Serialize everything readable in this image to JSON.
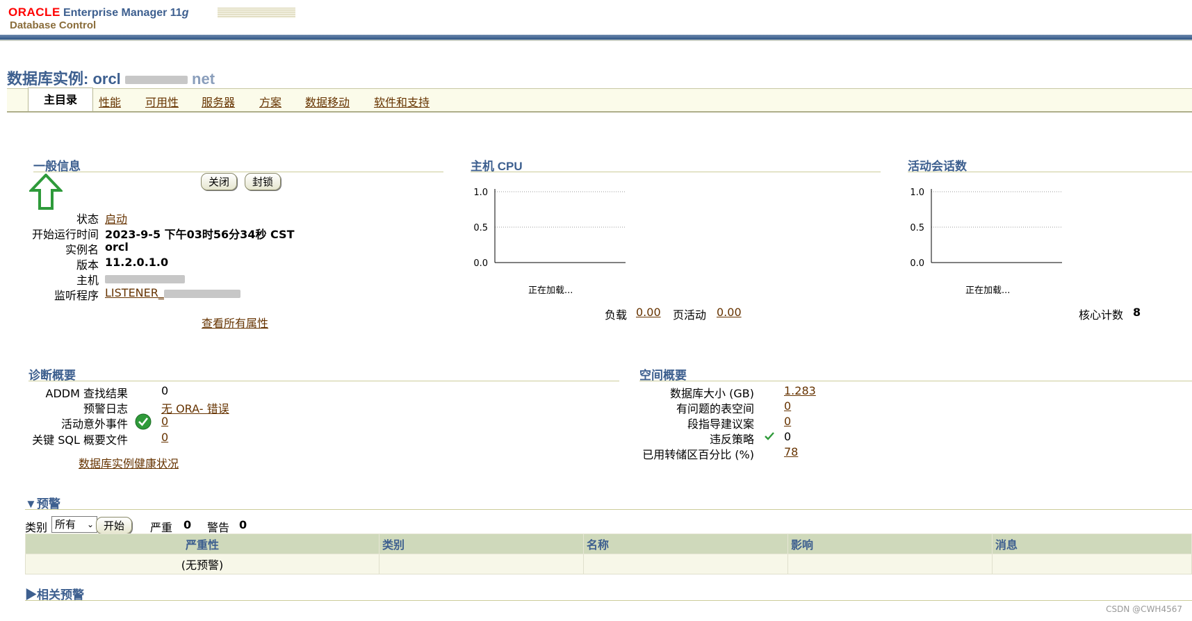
{
  "header": {
    "oracle": "ORACLE",
    "product": "Enterprise Manager 11",
    "product_version": "g",
    "subtitle": "Database Control"
  },
  "page": {
    "title_prefix": "数据库实例: orcl",
    "title_suffix": "net"
  },
  "tabs": [
    {
      "label": "主目录",
      "active": true
    },
    {
      "label": "性能"
    },
    {
      "label": "可用性"
    },
    {
      "label": "服务器"
    },
    {
      "label": "方案"
    },
    {
      "label": "数据移动"
    },
    {
      "label": "软件和支持"
    }
  ],
  "general": {
    "heading": "一般信息",
    "shutdown_btn": "关闭",
    "lock_btn": "封锁",
    "status_label": "状态",
    "status_value": "启动",
    "start_time_label": "开始运行时间",
    "start_time_value": "2023-9-5 下午03时56分34秒 CST",
    "instance_label": "实例名",
    "instance_value": "orcl",
    "version_label": "版本",
    "version_value": "11.2.0.1.0",
    "host_label": "主机",
    "listener_label": "监听程序",
    "listener_value": "LISTENER_",
    "view_all": "查看所有属性"
  },
  "cpu": {
    "heading": "主机 CPU",
    "loading": "正在加载...",
    "load_label": "负载",
    "load_value": "0.00",
    "paging_label": "页活动",
    "paging_value": "0.00"
  },
  "sessions": {
    "heading": "活动会话数",
    "loading": "正在加载...",
    "cores_label": "核心计数",
    "cores_value": "8"
  },
  "diagnostics": {
    "heading": "诊断概要",
    "addm_label": "ADDM 查找结果",
    "addm_value": "0",
    "alert_log_label": "预警日志",
    "alert_log_value": "无 ORA- 错误",
    "incidents_label": "活动意外事件",
    "incidents_value": "0",
    "sql_label": "关键 SQL 概要文件",
    "sql_value": "0",
    "health_link": "数据库实例健康状况"
  },
  "space": {
    "heading": "空间概要",
    "db_size_label": "数据库大小 (GB)",
    "db_size_value": "1.283",
    "problem_ts_label": "有问题的表空间",
    "problem_ts_value": "0",
    "segment_label": "段指导建议案",
    "segment_value": "0",
    "policy_label": "违反策略",
    "policy_value": "0",
    "archive_label": "已用转储区百分比 (%)",
    "archive_value": "78"
  },
  "alerts": {
    "heading": "预警",
    "category_label": "类别",
    "category_selected": "所有",
    "go_btn": "开始",
    "critical_label": "严重",
    "critical_value": "0",
    "warning_label": "警告",
    "warning_value": "0",
    "columns": [
      "严重性",
      "类别",
      "名称",
      "影响",
      "消息"
    ],
    "empty_row": "(无预警)"
  },
  "related": {
    "heading": "相关预警"
  },
  "watermark": "CSDN @CWH4567",
  "chart_data": [
    {
      "type": "line",
      "title": "主机 CPU",
      "ylim": [
        0.0,
        1.0
      ],
      "yticks": [
        "1.0",
        "0.5",
        "0.0"
      ],
      "series": []
    },
    {
      "type": "line",
      "title": "活动会话数",
      "ylim": [
        0.0,
        1.0
      ],
      "yticks": [
        "1.0",
        "0.5",
        "0.0"
      ],
      "series": []
    }
  ]
}
